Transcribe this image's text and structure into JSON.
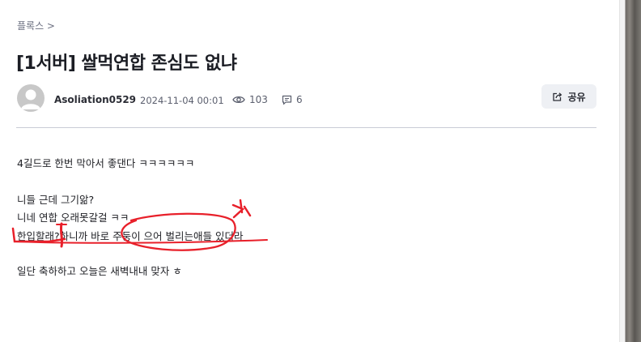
{
  "breadcrumb": "플록스 >",
  "post": {
    "title": "[1서버] 쌀먹연합 존심도 없냐",
    "author": "Asoliation0529",
    "date": "2024-11-04 00:01",
    "views": "103",
    "comments": "6",
    "share_label": "공유"
  },
  "body": {
    "line1": "4길드로 한번 막아서 좋댄다 ㅋㅋㅋㅋㅋㅋ",
    "line2": "니들 근데 그기앎?",
    "line3": "니네 연합 오래못갈걸 ㅋㅋ",
    "line4": "한입할래?하니까 바로 주둥이 으어 벌리는애들 있더라",
    "line5": "일단 축하하고 오늘은 새벽내내 맞자 ㅎ"
  },
  "icons": {
    "views": "eye-icon",
    "comments": "comment-icon",
    "share": "share-icon"
  },
  "colors": {
    "annotation": "#e8202a",
    "divider": "#c9ccd6",
    "button_bg": "#eef0f4"
  }
}
